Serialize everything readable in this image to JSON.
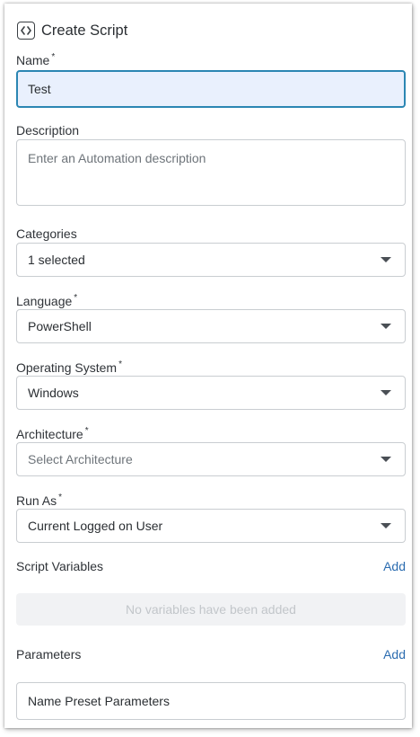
{
  "header": {
    "title": "Create Script",
    "icon": "code-brackets-icon"
  },
  "form": {
    "name": {
      "label": "Name",
      "required": "*",
      "value": "Test"
    },
    "description": {
      "label": "Description",
      "placeholder": "Enter an Automation description",
      "value": ""
    },
    "categories": {
      "label": "Categories",
      "value": "1 selected"
    },
    "language": {
      "label": "Language",
      "required": "*",
      "value": "PowerShell"
    },
    "operating_system": {
      "label": "Operating System",
      "required": "*",
      "value": "Windows"
    },
    "architecture": {
      "label": "Architecture",
      "required": "*",
      "placeholder": "Select Architecture"
    },
    "run_as": {
      "label": "Run As",
      "required": "*",
      "value": "Current Logged on User"
    }
  },
  "script_variables": {
    "label": "Script Variables",
    "add_label": "Add",
    "empty_text": "No variables have been added"
  },
  "parameters": {
    "label": "Parameters",
    "add_label": "Add",
    "preset_placeholder": "Name Preset Parameters"
  },
  "colors": {
    "accent": "#2b86b3",
    "focused_bg": "#e9f0fd",
    "link": "#2b6cb0"
  }
}
